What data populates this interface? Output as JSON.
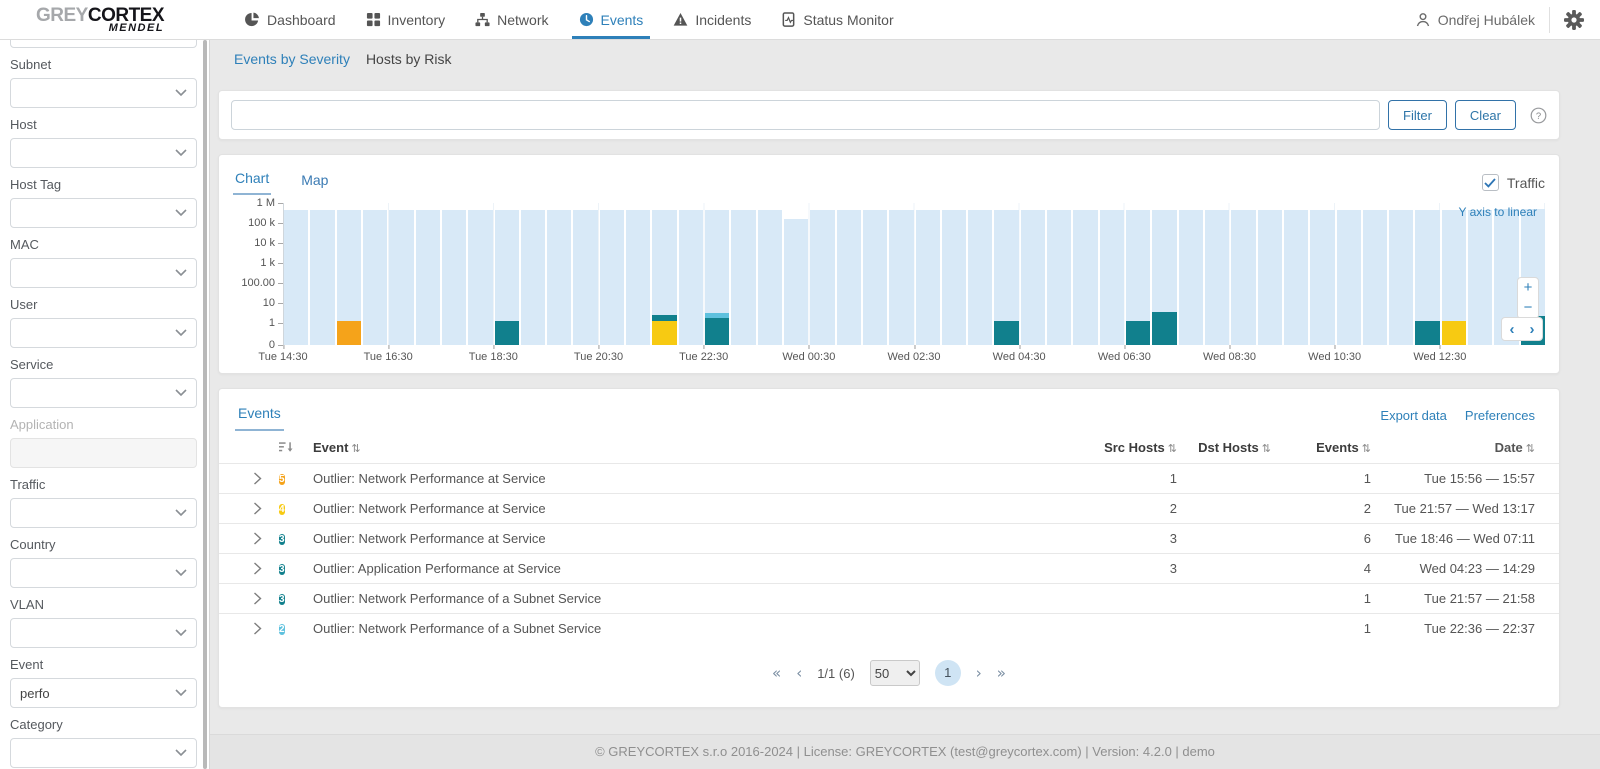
{
  "nav": {
    "logo": {
      "part_grey": "GREY",
      "part_black": "CORTEX",
      "sub": "MENDEL"
    },
    "items": [
      {
        "label": "Dashboard",
        "active": false
      },
      {
        "label": "Inventory",
        "active": false
      },
      {
        "label": "Network",
        "active": false
      },
      {
        "label": "Events",
        "active": true
      },
      {
        "label": "Incidents",
        "active": false
      },
      {
        "label": "Status Monitor",
        "active": false
      }
    ],
    "user": "Ondřej Hubálek"
  },
  "sidebar": {
    "filters": [
      {
        "label": "Subnet",
        "value": "",
        "disabled": false
      },
      {
        "label": "Host",
        "value": "",
        "disabled": false
      },
      {
        "label": "Host Tag",
        "value": "",
        "disabled": false
      },
      {
        "label": "MAC",
        "value": "",
        "disabled": false
      },
      {
        "label": "User",
        "value": "",
        "disabled": false
      },
      {
        "label": "Service",
        "value": "",
        "disabled": false
      },
      {
        "label": "Application",
        "value": "",
        "disabled": true
      },
      {
        "label": "Traffic",
        "value": "",
        "disabled": false
      },
      {
        "label": "Country",
        "value": "",
        "disabled": false
      },
      {
        "label": "VLAN",
        "value": "",
        "disabled": false
      },
      {
        "label": "Event",
        "value": "perfo",
        "disabled": false
      },
      {
        "label": "Category",
        "value": "",
        "disabled": false
      }
    ]
  },
  "subnav": {
    "links": [
      {
        "label": "Events by Severity",
        "active": true
      },
      {
        "label": "Hosts by Risk",
        "active": false
      }
    ]
  },
  "filterbar": {
    "input_value": "",
    "filter_label": "Filter",
    "clear_label": "Clear"
  },
  "chart_card": {
    "tabs": [
      {
        "label": "Chart",
        "active": true
      },
      {
        "label": "Map",
        "active": false
      }
    ],
    "traffic_checkbox": {
      "label": "Traffic",
      "checked": true
    },
    "linear_link": "Y axis to linear",
    "zoom_in": "+",
    "zoom_out": "−",
    "pan_left": "‹",
    "pan_right": "›"
  },
  "chart_data": {
    "type": "bar",
    "y_scale": "log",
    "title": "",
    "ylim": [
      0,
      1000000
    ],
    "y_tick_values": [
      1000000,
      100000,
      10000,
      1000,
      100,
      10,
      1,
      0
    ],
    "y_tick_labels": [
      "1 M",
      "100 k",
      "10 k",
      "1 k",
      "100.00",
      "10",
      "1",
      "0"
    ],
    "x_tick_labels": [
      "Tue 14:30",
      "Tue 16:30",
      "Tue 18:30",
      "Tue 20:30",
      "Tue 22:30",
      "Wed 00:30",
      "Wed 02:30",
      "Wed 04:30",
      "Wed 06:30",
      "Wed 08:30",
      "Wed 10:30",
      "Wed 12:30"
    ],
    "bucket_minutes": 30,
    "buckets": 48,
    "traffic_series": {
      "name": "Traffic",
      "color": "#d8e9f7",
      "values": [
        430000,
        455000,
        440000,
        460000,
        445000,
        465000,
        450000,
        435000,
        460000,
        442000,
        452000,
        468000,
        438000,
        455000,
        462000,
        444000,
        470000,
        452000,
        436000,
        150000,
        458000,
        450000,
        441000,
        463000,
        452000,
        468000,
        443000,
        452000,
        461000,
        437000,
        453000,
        462000,
        445000,
        469000,
        451000,
        458000,
        436000,
        452000,
        444000,
        461000,
        453000,
        467000,
        446000,
        452000,
        460000,
        447000,
        500000,
        480000
      ]
    },
    "event_series": [
      {
        "bucket": 2,
        "segments": [
          {
            "severity": "5",
            "color": "#f5a31a",
            "value": 1.3
          }
        ]
      },
      {
        "bucket": 8,
        "segments": [
          {
            "severity": "3",
            "color": "#11808d",
            "value": 1.3
          }
        ]
      },
      {
        "bucket": 14,
        "segments": [
          {
            "severity": "4",
            "color": "#f7ca12",
            "value": 1.3
          },
          {
            "severity": "3",
            "color": "#11808d",
            "value": 2.6
          }
        ]
      },
      {
        "bucket": 16,
        "segments": [
          {
            "severity": "3",
            "color": "#11808d",
            "value": 1.8
          },
          {
            "severity": "2",
            "color": "#5ec1de",
            "value": 3.2
          }
        ]
      },
      {
        "bucket": 27,
        "segments": [
          {
            "severity": "3",
            "color": "#11808d",
            "value": 1.3
          }
        ]
      },
      {
        "bucket": 32,
        "segments": [
          {
            "severity": "3",
            "color": "#11808d",
            "value": 1.3
          }
        ]
      },
      {
        "bucket": 33,
        "segments": [
          {
            "severity": "3",
            "color": "#11808d",
            "value": 3.5
          }
        ]
      },
      {
        "bucket": 43,
        "segments": [
          {
            "severity": "3",
            "color": "#11808d",
            "value": 1.3
          }
        ]
      },
      {
        "bucket": 44,
        "segments": [
          {
            "severity": "4",
            "color": "#f7ca12",
            "value": 1.3
          }
        ]
      },
      {
        "bucket": 47,
        "segments": [
          {
            "severity": "3",
            "color": "#11808d",
            "value": 2.2
          }
        ]
      }
    ]
  },
  "events_card": {
    "tab": "Events",
    "export_label": "Export data",
    "preferences_label": "Preferences",
    "sort_icon": "⇅",
    "columns": {
      "event": "Event",
      "src_hosts": "Src Hosts",
      "dst_hosts": "Dst Hosts",
      "events": "Events",
      "date": "Date"
    },
    "rows": [
      {
        "severity": "5",
        "severity_color": "#f5a31a",
        "event": "Outlier: Network Performance at Service",
        "src_hosts": "1",
        "dst_hosts": "",
        "events": "1",
        "date": "Tue 15:56 — 15:57"
      },
      {
        "severity": "4",
        "severity_color": "#f7ca12",
        "event": "Outlier: Network Performance at Service",
        "src_hosts": "2",
        "dst_hosts": "",
        "events": "2",
        "date": "Tue 21:57 — Wed 13:17"
      },
      {
        "severity": "3",
        "severity_color": "#11808d",
        "event": "Outlier: Network Performance at Service",
        "src_hosts": "3",
        "dst_hosts": "",
        "events": "6",
        "date": "Tue 18:46 — Wed 07:11"
      },
      {
        "severity": "3",
        "severity_color": "#11808d",
        "event": "Outlier: Application Performance at Service",
        "src_hosts": "3",
        "dst_hosts": "",
        "events": "4",
        "date": "Wed 04:23 — 14:29"
      },
      {
        "severity": "3",
        "severity_color": "#11808d",
        "event": "Outlier: Network Performance of a Subnet Service",
        "src_hosts": "",
        "dst_hosts": "",
        "events": "1",
        "date": "Tue 21:57 — 21:58"
      },
      {
        "severity": "2",
        "severity_color": "#5ec1de",
        "event": "Outlier: Network Performance of a Subnet Service",
        "src_hosts": "",
        "dst_hosts": "",
        "events": "1",
        "date": "Tue 22:36 — 22:37"
      }
    ],
    "pagination": {
      "first": "«",
      "prev": "‹",
      "info": "1/1 (6)",
      "page_size": "50",
      "page": "1",
      "next": "›",
      "last": "»"
    }
  },
  "footer": {
    "text": "© GREYCORTEX s.r.o 2016-2024 | License: GREYCORTEX (test@greycortex.com) | Version: 4.2.0 | demo"
  }
}
